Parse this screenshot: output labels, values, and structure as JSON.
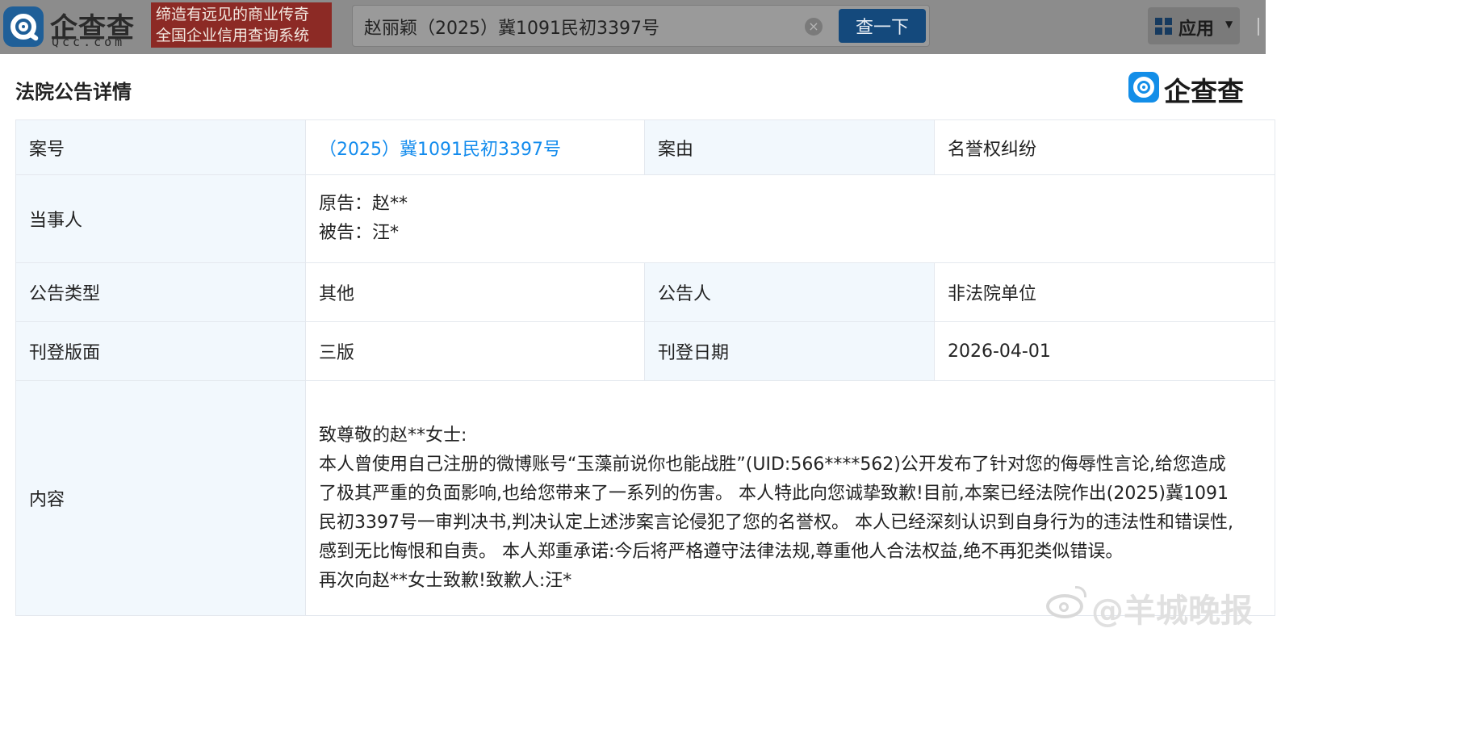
{
  "header": {
    "logo_cn": "企查查",
    "logo_en": "Qcc.com",
    "slogan_line1": "缔造有远见的商业传奇",
    "slogan_line2": "全国企业信用查询系统",
    "search_value": "赵丽颖（2025）冀1091民初3397号",
    "search_button": "查一下",
    "apps_label": "应用",
    "icons": [
      "qcc-logo-icon",
      "clear-icon",
      "apps-grid-icon",
      "chevron-down-icon"
    ]
  },
  "page": {
    "title": "法院公告详情",
    "brand_text": "企查查"
  },
  "table": {
    "case_no_label": "案号",
    "case_no": "（2025）冀1091民初3397号",
    "cause_label": "案由",
    "cause": "名誉权纠纷",
    "parties_label": "当事人",
    "parties": [
      "原告：赵**",
      "被告：汪*"
    ],
    "notice_type_label": "公告类型",
    "notice_type": "其他",
    "announcer_label": "公告人",
    "announcer": "非法院单位",
    "page_label": "刊登版面",
    "page_value": "三版",
    "date_label": "刊登日期",
    "date_value": "2026-04-01",
    "content_label": "内容",
    "content_lines": [
      "致尊敬的赵**女士:",
      "本人曾使用自己注册的微博账号“玉藻前说你也能战胜”(UID:566****562)公开发布了针对您的侮辱性言论,给您造成",
      "了极其严重的负面影响,也给您带来了一系列的伤害。 本人特此向您诚挚致歉!目前,本案已经法院作出(2025)冀1091",
      "民初3397号一审判决书,判决认定上述涉案言论侵犯了您的名誉权。 本人已经深刻认识到自身行为的违法性和错误性,",
      "感到无比悔恨和自责。 本人郑重承诺:今后将严格遵守法律法规,尊重他人合法权益,绝不再犯类似错误。",
      "再次向赵**女士致歉!致歉人:汪*"
    ]
  },
  "watermark": {
    "text": "@羊城晚报"
  },
  "colors": {
    "link": "#128bed",
    "label_bg": "#f2f8fd",
    "header_bg": "#8c8c8c",
    "search_button_bg": "#14497c"
  }
}
